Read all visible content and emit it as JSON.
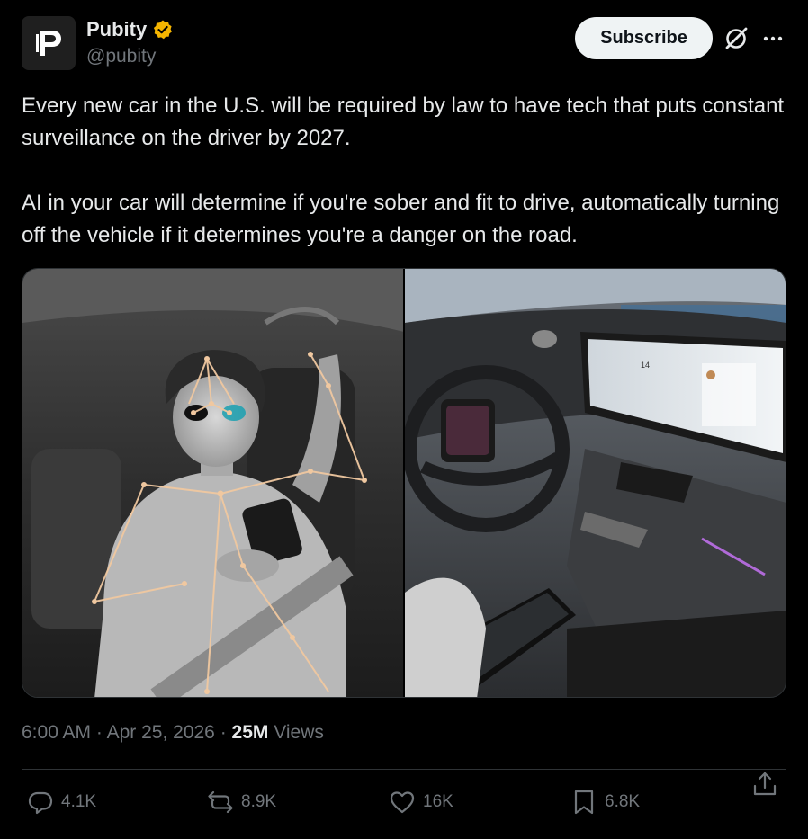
{
  "author": {
    "name": "Pubity",
    "handle": "@pubity",
    "avatar_letter": "P",
    "verified_badge_color": "#f4b400"
  },
  "header": {
    "subscribe_label": "Subscribe",
    "grok_icon": "grok-icon",
    "more_icon": "more-icon"
  },
  "post": {
    "text": "Every new car in the U.S. will be required by law to have tech that puts constant surveillance on the driver by 2027.\n\nAI in your car will determine if you're sober and fit to drive, automatically turning off the vehicle if it determines you're a danger on the road."
  },
  "media": {
    "images": [
      {
        "name": "driver-monitoring-image",
        "screen_speed": "14"
      },
      {
        "name": "car-dashboard-image",
        "dash_number": "14"
      }
    ]
  },
  "meta": {
    "time": "6:00 AM",
    "separator": "·",
    "date": "Apr 25, 2026",
    "views_count": "25M",
    "views_label": "Views"
  },
  "actions": {
    "replies": "4.1K",
    "reposts": "8.9K",
    "likes": "16K",
    "bookmarks": "6.8K"
  },
  "colors": {
    "background": "#000000",
    "text": "#e7e9ea",
    "muted": "#71767b",
    "divider": "#2f3336",
    "skeleton": "#f0c8a0"
  }
}
